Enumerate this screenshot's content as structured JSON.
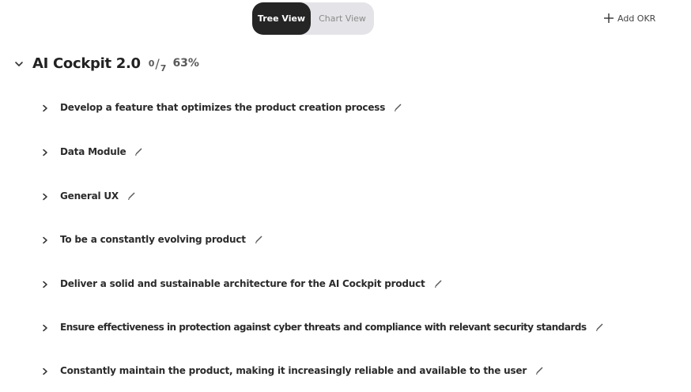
{
  "toolbar": {
    "tree_view_label": "Tree View",
    "chart_view_label": "Chart View",
    "active_view": "Tree View",
    "add_okr_label": "Add OKR",
    "add_icon": "plus-icon"
  },
  "okr": {
    "title": "AI Cockpit 2.0",
    "completed": "0",
    "total": "7",
    "progress": "63%",
    "expanded": true,
    "objectives": [
      {
        "label": "Develop a feature that optimizes the product creation process"
      },
      {
        "label": "Data Module"
      },
      {
        "label": "General UX"
      },
      {
        "label": "To be a constantly evolving product"
      },
      {
        "label": "Deliver a solid and sustainable architecture for the AI Cockpit product"
      },
      {
        "label": "Ensure effectiveness in protection against cyber threats and compliance with relevant security standards"
      },
      {
        "label": "Constantly maintain the product, making it increasingly reliable and available to the user"
      }
    ]
  },
  "colors": {
    "active_toggle_bg": "#252525",
    "toggle_track_bg": "#e4e4e8",
    "text_primary": "#2b2b2b",
    "text_muted": "#5a5a5a",
    "edit_icon": "#555555"
  }
}
